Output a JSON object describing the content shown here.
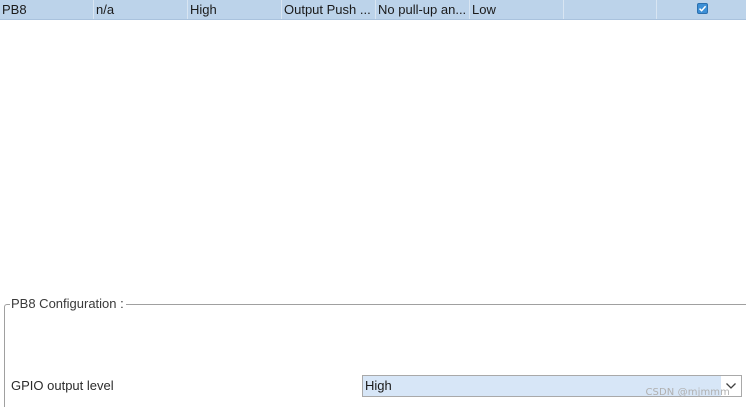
{
  "gpio_table": {
    "rows": [
      {
        "pin": "PB8",
        "signal": "n/a",
        "output_level": "High",
        "mode": "Output Push ...",
        "pull": "No pull-up an...",
        "speed": "Low",
        "user_label": "",
        "modified": true
      }
    ]
  },
  "config": {
    "title": "PB8 Configuration :",
    "fields": [
      {
        "label": "GPIO output level",
        "value": "High"
      }
    ]
  },
  "watermark": "CSDN @mjmmm",
  "colors": {
    "selected_row": "#bcd3ea",
    "select_bg": "#d7e6f7",
    "checkbox": "#3c8fd6"
  },
  "icons": {
    "checkbox": "check-icon",
    "dropdown": "chevron-down-icon"
  }
}
